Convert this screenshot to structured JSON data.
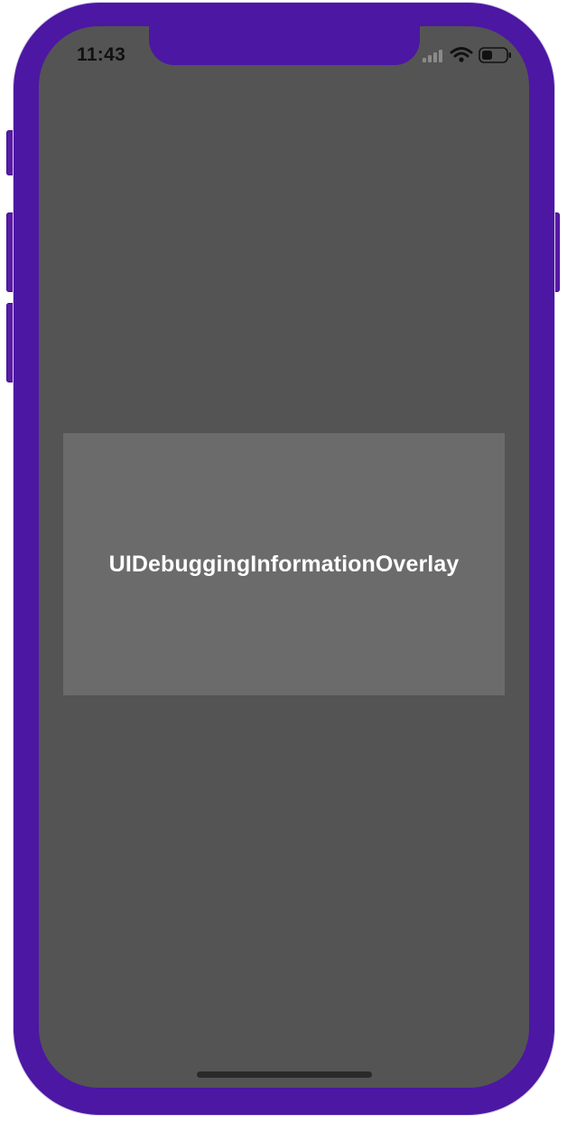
{
  "status_bar": {
    "time": "11:43",
    "signal_icon": "cellular-signal-icon",
    "wifi_icon": "wifi-icon",
    "battery_icon": "battery-icon",
    "battery_level": 0.45
  },
  "overlay": {
    "label": "UIDebuggingInformationOverlay"
  },
  "colors": {
    "device_frame": "#4c17a3",
    "screen_background": "#545454",
    "overlay_background": "#6b6b6b",
    "overlay_text": "#ffffff"
  }
}
